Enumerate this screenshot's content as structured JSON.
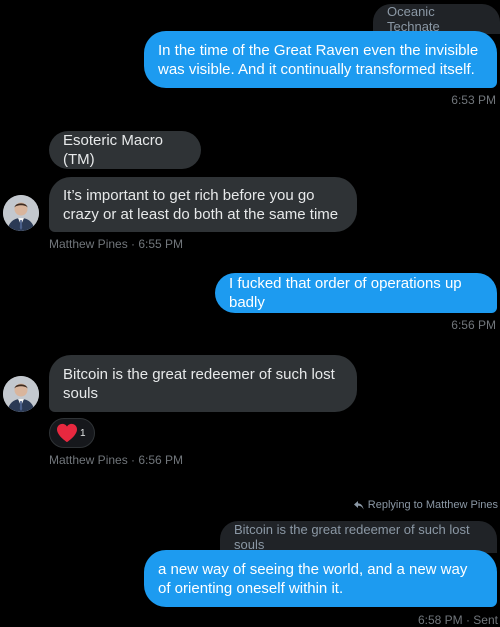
{
  "messages": {
    "m1": {
      "quote": "Oceanic Technate",
      "text": "In the time of the Great Raven even the invisible was visible. And it continually transformed itself.",
      "time": "6:53 PM"
    },
    "m2": {
      "name_bubble": "Esoteric Macro (TM)",
      "text": "It’s important to get rich before you go crazy or at least do both at the same time",
      "meta": "Matthew Pines · 6:55 PM"
    },
    "m3": {
      "text": "I fucked that order of operations up badly",
      "time": "6:56 PM"
    },
    "m4": {
      "text": "Bitcoin is the great redeemer of such lost souls",
      "reaction_emoji": "heart",
      "reaction_count": "1",
      "meta": "Matthew Pines · 6:56 PM"
    },
    "m5": {
      "replying_to": "Replying to Matthew Pines",
      "quote": "Bitcoin is the great redeemer of such lost souls",
      "text": "a new way of seeing the world, and a new way of orienting oneself within it.",
      "meta": "6:58 PM · Sent"
    }
  },
  "colors": {
    "background": "#000000",
    "sent_bubble": "#1d9bf0",
    "received_bubble": "#2f3336",
    "quote_bubble": "#202327",
    "muted_text": "#71767b",
    "heart": "#f91880"
  },
  "icons": {
    "reaction": "heart-icon",
    "reply": "reply-arrow-icon"
  }
}
